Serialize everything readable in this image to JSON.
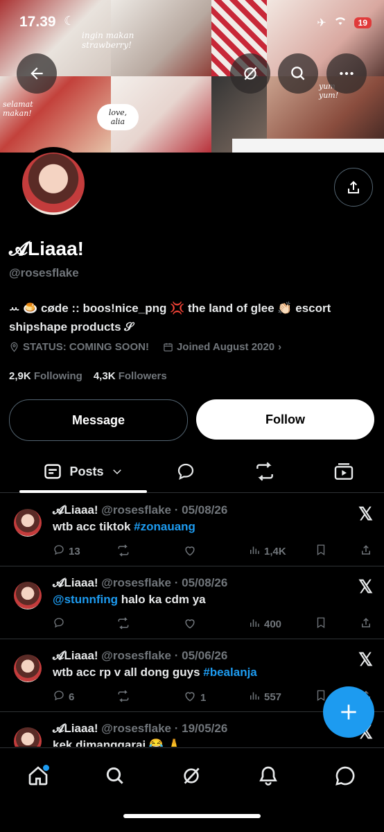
{
  "status_bar": {
    "time": "17.39",
    "moon": "☾",
    "battery": "19"
  },
  "banner": {
    "caption_1": "ingin makan strawberry!",
    "caption_2": "love, alia",
    "caption_3": "selamat makan!",
    "caption_4": "yum yum!"
  },
  "header_buttons": [
    "back-icon",
    "grok-icon",
    "search-icon",
    "more-icon"
  ],
  "profile": {
    "name": "𝓐Liaaa!",
    "handle": "@rosesflake",
    "bio": "ꕀ 🍮 cøde :: boos!nice_png 💢 the land of glee 👏🏻 escort shipshape products 𝒮",
    "location": "STATUS: COMING SOON!",
    "joined": "Joined August 2020",
    "following_count": "2,9K",
    "following_label": "Following",
    "followers_count": "4,3K",
    "followers_label": "Followers"
  },
  "buttons": {
    "message": "Message",
    "follow": "Follow"
  },
  "tabs": {
    "active_label": "Posts"
  },
  "tweets": [
    {
      "name": "𝓐Liaaa!",
      "handle": "@rosesflake",
      "date": "05/08/26",
      "text": "wtb acc tiktok ",
      "link": "#zonauang",
      "link_first": false,
      "replies": "13",
      "reposts": "",
      "likes": "",
      "views": "1,4K"
    },
    {
      "name": "𝓐Liaaa!",
      "handle": "@rosesflake",
      "date": "05/08/26",
      "text": " halo ka cdm ya",
      "link": "@stunnfing",
      "link_first": true,
      "replies": "",
      "reposts": "",
      "likes": "",
      "views": "400"
    },
    {
      "name": "𝓐Liaaa!",
      "handle": "@rosesflake",
      "date": "05/06/26",
      "text": "wtb acc rp v all dong guys ",
      "link": "#bealanja",
      "link_first": false,
      "replies": "6",
      "reposts": "",
      "likes": "1",
      "views": "557"
    },
    {
      "name": "𝓐Liaaa!",
      "handle": "@rosesflake",
      "date": "19/05/26",
      "text": "kek dimanggarai 😂 🙏",
      "link": "",
      "link_first": false,
      "replies": "",
      "reposts": "",
      "likes": "",
      "views": ""
    }
  ],
  "bottom_nav": [
    "home-icon",
    "search-icon",
    "grok-icon",
    "notifications-icon",
    "messages-icon"
  ],
  "colors": {
    "accent": "#1d9bf0",
    "muted": "#71767b",
    "border": "#2f3336"
  }
}
